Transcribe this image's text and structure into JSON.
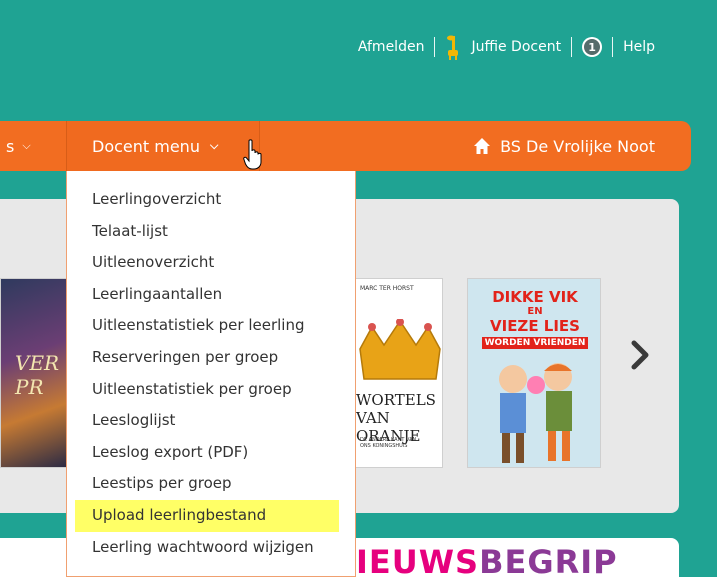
{
  "topbar": {
    "logout": "Afmelden",
    "user": "Juffie Docent",
    "notification_count": "1",
    "help": "Help"
  },
  "nav": {
    "prev_label": "s",
    "docent_menu": "Docent menu",
    "school": "BS De Vrolijke Noot"
  },
  "dropdown": {
    "items": [
      "Leerlingoverzicht",
      "Telaat-lijst",
      "Uitleenoverzicht",
      "Leerlingaantallen",
      "Uitleenstatistiek per leerling",
      "Reserveringen per groep",
      "Uitleenstatistiek per groep",
      "Leesloglijst",
      "Leeslog export (PDF)",
      "Leestips per groep",
      "Upload leerlingbestand",
      "Leerling wachtwoord wijzigen"
    ],
    "highlighted_index": 10
  },
  "carousel": {
    "books": [
      {
        "title": "VER PR"
      },
      {
        "author": "MARC TER HORST",
        "title": "WORTELS VAN ORANJE",
        "subtitle": "DE ANDERE KANT VAN ONS KONINGSHUIS"
      },
      {
        "title_line1": "DIKKE VIK",
        "title_line2": "EN",
        "title_line3": "VIEZE LIES",
        "title_line4": "WORDEN VRIENDEN"
      }
    ]
  },
  "banner": {
    "part_a": "IEUWS",
    "part_b": "BEGRIP"
  },
  "colors": {
    "background": "#1fa393",
    "nav": "#f26d21",
    "highlight": "#ffff66"
  }
}
